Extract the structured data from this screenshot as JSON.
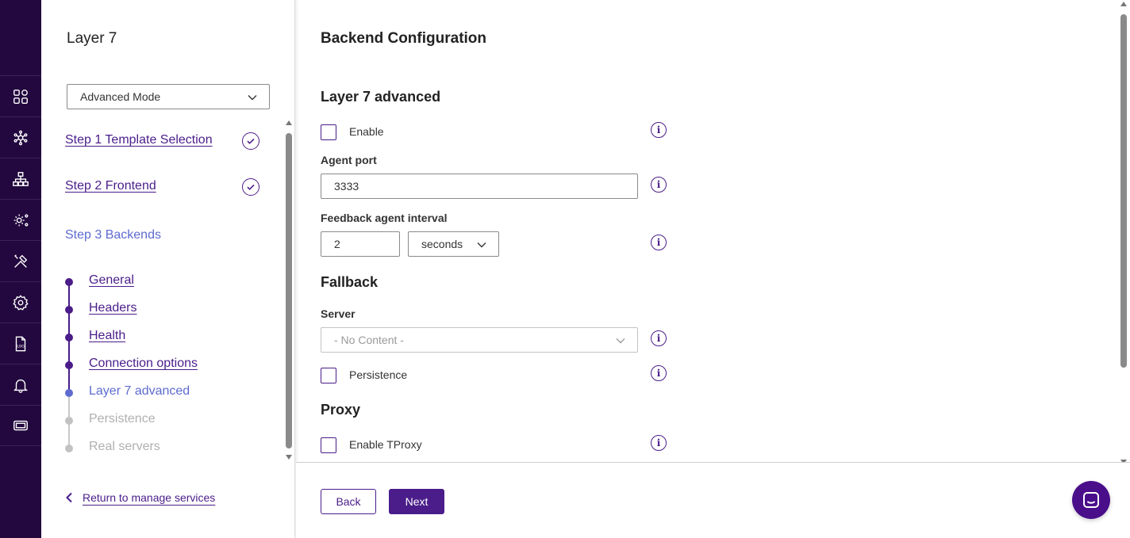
{
  "rail": {
    "icons": [
      "apps-icon",
      "cluster-icon",
      "network-icon",
      "services-settings-icon",
      "tools-icon",
      "settings-icon",
      "log-icon",
      "bell-icon",
      "ticket-icon"
    ],
    "log_label": "LOG"
  },
  "wizard": {
    "title": "Layer 7",
    "mode_select": "Advanced Mode",
    "steps": [
      {
        "label": "Step 1 Template Selection",
        "status": "done"
      },
      {
        "label": "Step 2 Frontend",
        "status": "done"
      },
      {
        "label": "Step 3 Backends",
        "status": "current"
      }
    ],
    "substeps": [
      {
        "label": "General",
        "status": "done"
      },
      {
        "label": "Headers",
        "status": "done"
      },
      {
        "label": "Health",
        "status": "done"
      },
      {
        "label": "Connection options",
        "status": "done"
      },
      {
        "label": "Layer 7 advanced",
        "status": "active"
      },
      {
        "label": "Persistence",
        "status": "todo"
      },
      {
        "label": "Real servers",
        "status": "todo"
      }
    ],
    "return_link": "Return to manage services"
  },
  "main": {
    "title": "Backend Configuration",
    "l7_section": "Layer 7 advanced",
    "enable_label": "Enable",
    "agent_port_label": "Agent port",
    "agent_port_value": "3333",
    "feedback_label": "Feedback agent interval",
    "feedback_value": "2",
    "feedback_unit": "seconds",
    "fallback_section": "Fallback",
    "server_label": "Server",
    "server_value": "- No Content -",
    "persistence_label": "Persistence",
    "proxy_section": "Proxy",
    "tproxy_label": "Enable TProxy",
    "info_glyph": "i"
  },
  "footer": {
    "back_label": "Back",
    "next_label": "Next"
  },
  "colors": {
    "brand": "#4a1d8a",
    "rail_bg": "#23083f",
    "active_step": "#5d6bd0"
  }
}
